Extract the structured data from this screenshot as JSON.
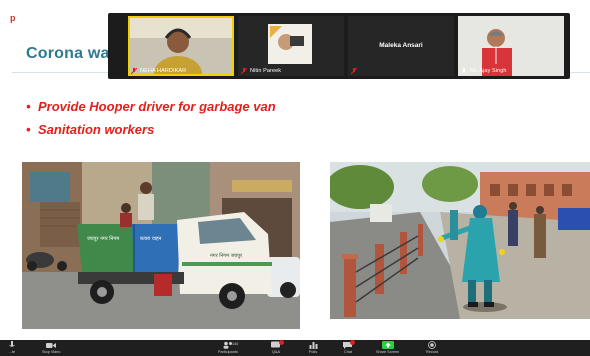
{
  "slide": {
    "mark": "p",
    "title": "Corona wa",
    "bullets": [
      "Provide Hooper driver for garbage van",
      "Sanitation workers"
    ],
    "photo_left": {
      "van_text_1": "कचरा वाहन",
      "van_text_2": "नगर निगम जयपुर",
      "van_text_3": "जयपुर नगर निगम"
    }
  },
  "participants": [
    {
      "name": "NEHA HARDIKAR",
      "active": true
    },
    {
      "name": "Nitin Pareek",
      "active": false
    },
    {
      "name": "Maleka Ansari",
      "active": false
    },
    {
      "name": "Mr. Ajay Singh",
      "active": false
    }
  ],
  "toolbar": {
    "items": [
      {
        "label": "...te",
        "icon": "mic-icon"
      },
      {
        "label": "Stop Video",
        "icon": "video-camera-icon"
      },
      {
        "label": "Participants",
        "icon": "participants-icon",
        "count": "140"
      },
      {
        "label": "Q&A",
        "icon": "qa-icon"
      },
      {
        "label": "Polls",
        "icon": "polls-icon"
      },
      {
        "label": "Chat",
        "icon": "chat-icon"
      },
      {
        "label": "Share Screen",
        "icon": "share-screen-icon"
      },
      {
        "label": "Record",
        "icon": "record-icon"
      }
    ]
  },
  "colors": {
    "title": "#2f7a8f",
    "bullet": "#e3201b",
    "share_green": "#2ecc40",
    "active_speaker": "#f0d000"
  }
}
